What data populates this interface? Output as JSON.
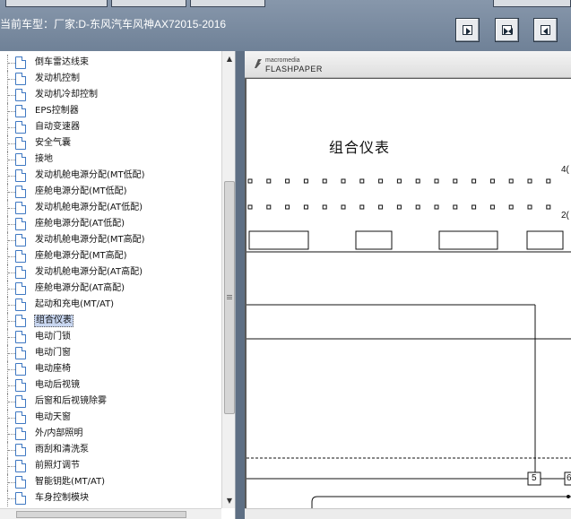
{
  "header": {
    "title": "当前车型：厂家:D-东风汽车风神AX72015-2016",
    "nav_buttons": [
      {
        "name": "next-page",
        "icon": "arrow-right-icon"
      },
      {
        "name": "fit-page",
        "icon": "arrows-inward-icon"
      },
      {
        "name": "prev-page",
        "icon": "arrow-left-icon"
      }
    ]
  },
  "tree": {
    "items": [
      {
        "label": "倒车雷达线束"
      },
      {
        "label": "发动机控制"
      },
      {
        "label": "发动机冷却控制"
      },
      {
        "label": "EPS控制器"
      },
      {
        "label": "自动变速器"
      },
      {
        "label": "安全气囊"
      },
      {
        "label": "接地"
      },
      {
        "label": "发动机舱电源分配(MT低配)"
      },
      {
        "label": "座舱电源分配(MT低配)"
      },
      {
        "label": "发动机舱电源分配(AT低配)"
      },
      {
        "label": "座舱电源分配(AT低配)"
      },
      {
        "label": "发动机舱电源分配(MT高配)"
      },
      {
        "label": "座舱电源分配(MT高配)"
      },
      {
        "label": "发动机舱电源分配(AT高配)"
      },
      {
        "label": "座舱电源分配(AT高配)"
      },
      {
        "label": "起动和充电(MT/AT)"
      },
      {
        "label": "组合仪表",
        "selected": true
      },
      {
        "label": "电动门锁"
      },
      {
        "label": "电动门窗"
      },
      {
        "label": "电动座椅"
      },
      {
        "label": "电动后视镜"
      },
      {
        "label": "后窗和后视镜除雾"
      },
      {
        "label": "电动天窗"
      },
      {
        "label": "外/内部照明"
      },
      {
        "label": "雨刮和清洗泵"
      },
      {
        "label": "前照灯调节"
      },
      {
        "label": "智能钥匙(MT/AT)"
      },
      {
        "label": "车身控制模块"
      }
    ]
  },
  "viewer": {
    "brand_small": "macromedia",
    "brand_big": "FLASHPAPER",
    "doc_title": "组合仪表",
    "pin_labels": {
      "top_right_1": "4(",
      "top_right_2": "2(",
      "bottom_1": "5",
      "bottom_2": "6"
    }
  },
  "colors": {
    "toolbar": "#7f8fa3",
    "selection": "#c9d7f1",
    "icon_blue": "#3f78c2"
  }
}
